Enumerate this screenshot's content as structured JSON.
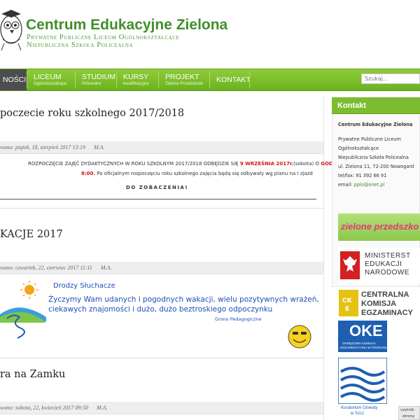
{
  "header": {
    "title": "Centrum Edukacyjne Zielona",
    "subtitle1": "Prywatne Publiczne Liceum Ogólnokształcące",
    "subtitle2": "Niepubliczna Szkoła Policealna"
  },
  "nav": {
    "items": [
      {
        "label": "NOŚCI",
        "sub": ""
      },
      {
        "label": "LICEUM",
        "sub": "Ogólnokształcące"
      },
      {
        "label": "STUDIUM",
        "sub": "Policealne"
      },
      {
        "label": "KURSY",
        "sub": "kwalifikacyjne"
      },
      {
        "label": "PROJEKT",
        "sub": "Zielone Przedszkole"
      },
      {
        "label": "KONTAKT",
        "sub": ""
      }
    ],
    "search_placeholder": "Szukaj..."
  },
  "posts": [
    {
      "title": "poczecie roku szkolnego 2017/2018",
      "meta_date": "wano: piątek, 18, sierpień 2017 13:19",
      "meta_author": "M.A.",
      "text_line1_a": "ROZPOCZĘCIE ZAJĘĆ DYDAKTYCZNYCH W ROKU SZKOLNYM 2017/2018 ODBĘDZIE SIĘ ",
      "text_line1_red1": "9 WRZEŚNIA 2017r.",
      "text_line1_b": "(sobota) O ",
      "text_line1_red2": "GODZ.",
      "text_line2_red": "8:00.",
      "text_line2_b": " Po oficjalnym rozpoczęciu roku szkolnego zajęcia będą się odbywały wg planu na I zjazd",
      "closing": "DO ZOBACZENIA!"
    },
    {
      "title": "KACJE 2017",
      "meta_date": "wano: czwartek, 22, czerwiec 2017 11:11",
      "meta_author": "M.A.",
      "card_greeting": "Drodzy Słuchacze",
      "card_line1": "Życzymy Wam udanych i  pogodnych wakacji,  wielu pozytywnych wrażeń,",
      "card_line2": "ciekawych znajomości i dużo, dużo beztroskiego odpoczynku",
      "card_sign": "Grono Pedagogiczne"
    },
    {
      "title": "ra na Zamku",
      "meta_date": "wano: sobota, 22, kwiecień 2017 09:50",
      "meta_author": "M.A."
    }
  ],
  "sidebar": {
    "kontakt_title": "Kontakt",
    "org_name": "Centrum Edukacyjne Zielona",
    "lines": [
      "Prywatne Publiczne Liceum",
      "Ogólnokształcące",
      "Niepubliczna Szkoła Policealna",
      "ul. Zielona 11, 72-200 Nowogard",
      "tel/fax: 91 392 66 91"
    ],
    "email_label": "email: ",
    "email": "pplo@onet.pl",
    "banners": {
      "zielone": "zielone przedszko",
      "men_line1": "MINISTERST",
      "men_line2": "EDUKACJI",
      "men_line3": "NARODOWE",
      "cke_line1": "CENTRALNA",
      "cke_line2": "KOMISJA",
      "cke_line3": "EGZAMINACY",
      "oke": "OKE",
      "oke_sub1": "OKRĘGOWA KOMISJA",
      "oke_sub2": "EGZAMINACYJNA W POZNANIU",
      "kuratorium": "Kuratorium Oświaty",
      "kuratorium2": "w Szcz"
    }
  },
  "reader": {
    "label1": "czytnik",
    "label2": "strony"
  },
  "colors": {
    "brand_green": "#7cbd2f",
    "title_green": "#3f8f2a",
    "red": "#d01818",
    "card_blue": "#1d4fb8"
  }
}
